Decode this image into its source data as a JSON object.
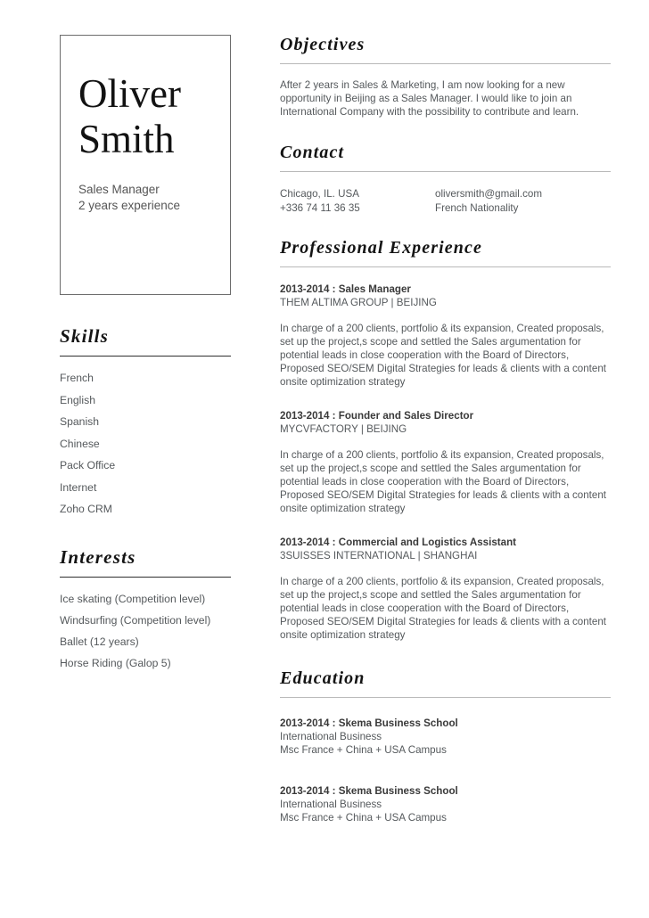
{
  "header": {
    "first_name": "Oliver",
    "last_name": "Smith",
    "role": "Sales Manager",
    "experience": "2 years experience"
  },
  "skills": {
    "title": "Skills",
    "items": [
      "French",
      "English",
      "Spanish",
      "Chinese",
      "Pack Office",
      "Internet",
      "Zoho CRM"
    ]
  },
  "interests": {
    "title": "Interests",
    "items": [
      "Ice skating (Competition level)",
      "Windsurfing (Competition level)",
      "Ballet (12 years)",
      "Horse Riding (Galop 5)"
    ]
  },
  "objectives": {
    "title": "Objectives",
    "text": "After 2 years in Sales & Marketing, I am now looking for a new opportunity in Beijing as a Sales Manager. I would like to join an International Company with the possibility to contribute and learn."
  },
  "contact": {
    "title": "Contact",
    "location": "Chicago, IL. USA",
    "phone": "+336 74 11 36 35",
    "email": "oliversmith@gmail.com",
    "nationality": "French Nationality"
  },
  "experience": {
    "title": "Professional Experience",
    "entries": [
      {
        "title": "2013-2014 : Sales Manager",
        "org": "THEM ALTIMA GROUP | BEIJING",
        "description": "In charge of a 200 clients, portfolio & its expansion, Created proposals, set up the project,s scope and settled the Sales argumentation for potential leads in close cooperation with the Board of Directors, Proposed SEO/SEM Digital Strategies for leads & clients with a content onsite optimization strategy"
      },
      {
        "title": "2013-2014 : Founder and Sales Director",
        "org": "MYCVFACTORY | BEIJING",
        "description": "In charge of a 200 clients, portfolio & its expansion, Created proposals, set up the project,s scope and settled the Sales argumentation for potential leads in close cooperation with the Board of Directors, Proposed SEO/SEM Digital Strategies for leads & clients with a content onsite optimization strategy"
      },
      {
        "title": "2013-2014 : Commercial and Logistics Assistant",
        "org": "3SUISSES INTERNATIONAL | SHANGHAI",
        "description": "In charge of a 200 clients, portfolio & its expansion, Created proposals, set up the project,s scope and settled the Sales argumentation for potential leads in close cooperation with the Board of Directors, Proposed SEO/SEM Digital Strategies for leads & clients with a content onsite optimization strategy"
      }
    ]
  },
  "education": {
    "title": "Education",
    "entries": [
      {
        "title": "2013-2014 : Skema Business School",
        "program": "International Business",
        "detail": "Msc France + China + USA Campus"
      },
      {
        "title": "2013-2014 : Skema Business School",
        "program": "International Business",
        "detail": "Msc France + China + USA Campus"
      }
    ]
  },
  "colors": {
    "page_background": "#ffffff",
    "heading_text": "#141414",
    "body_text": "#55595c",
    "name_text": "#121212",
    "box_border": "#6c6c6c",
    "rule_left": "#2f2f2f",
    "rule_right": "#b9b9b9"
  }
}
